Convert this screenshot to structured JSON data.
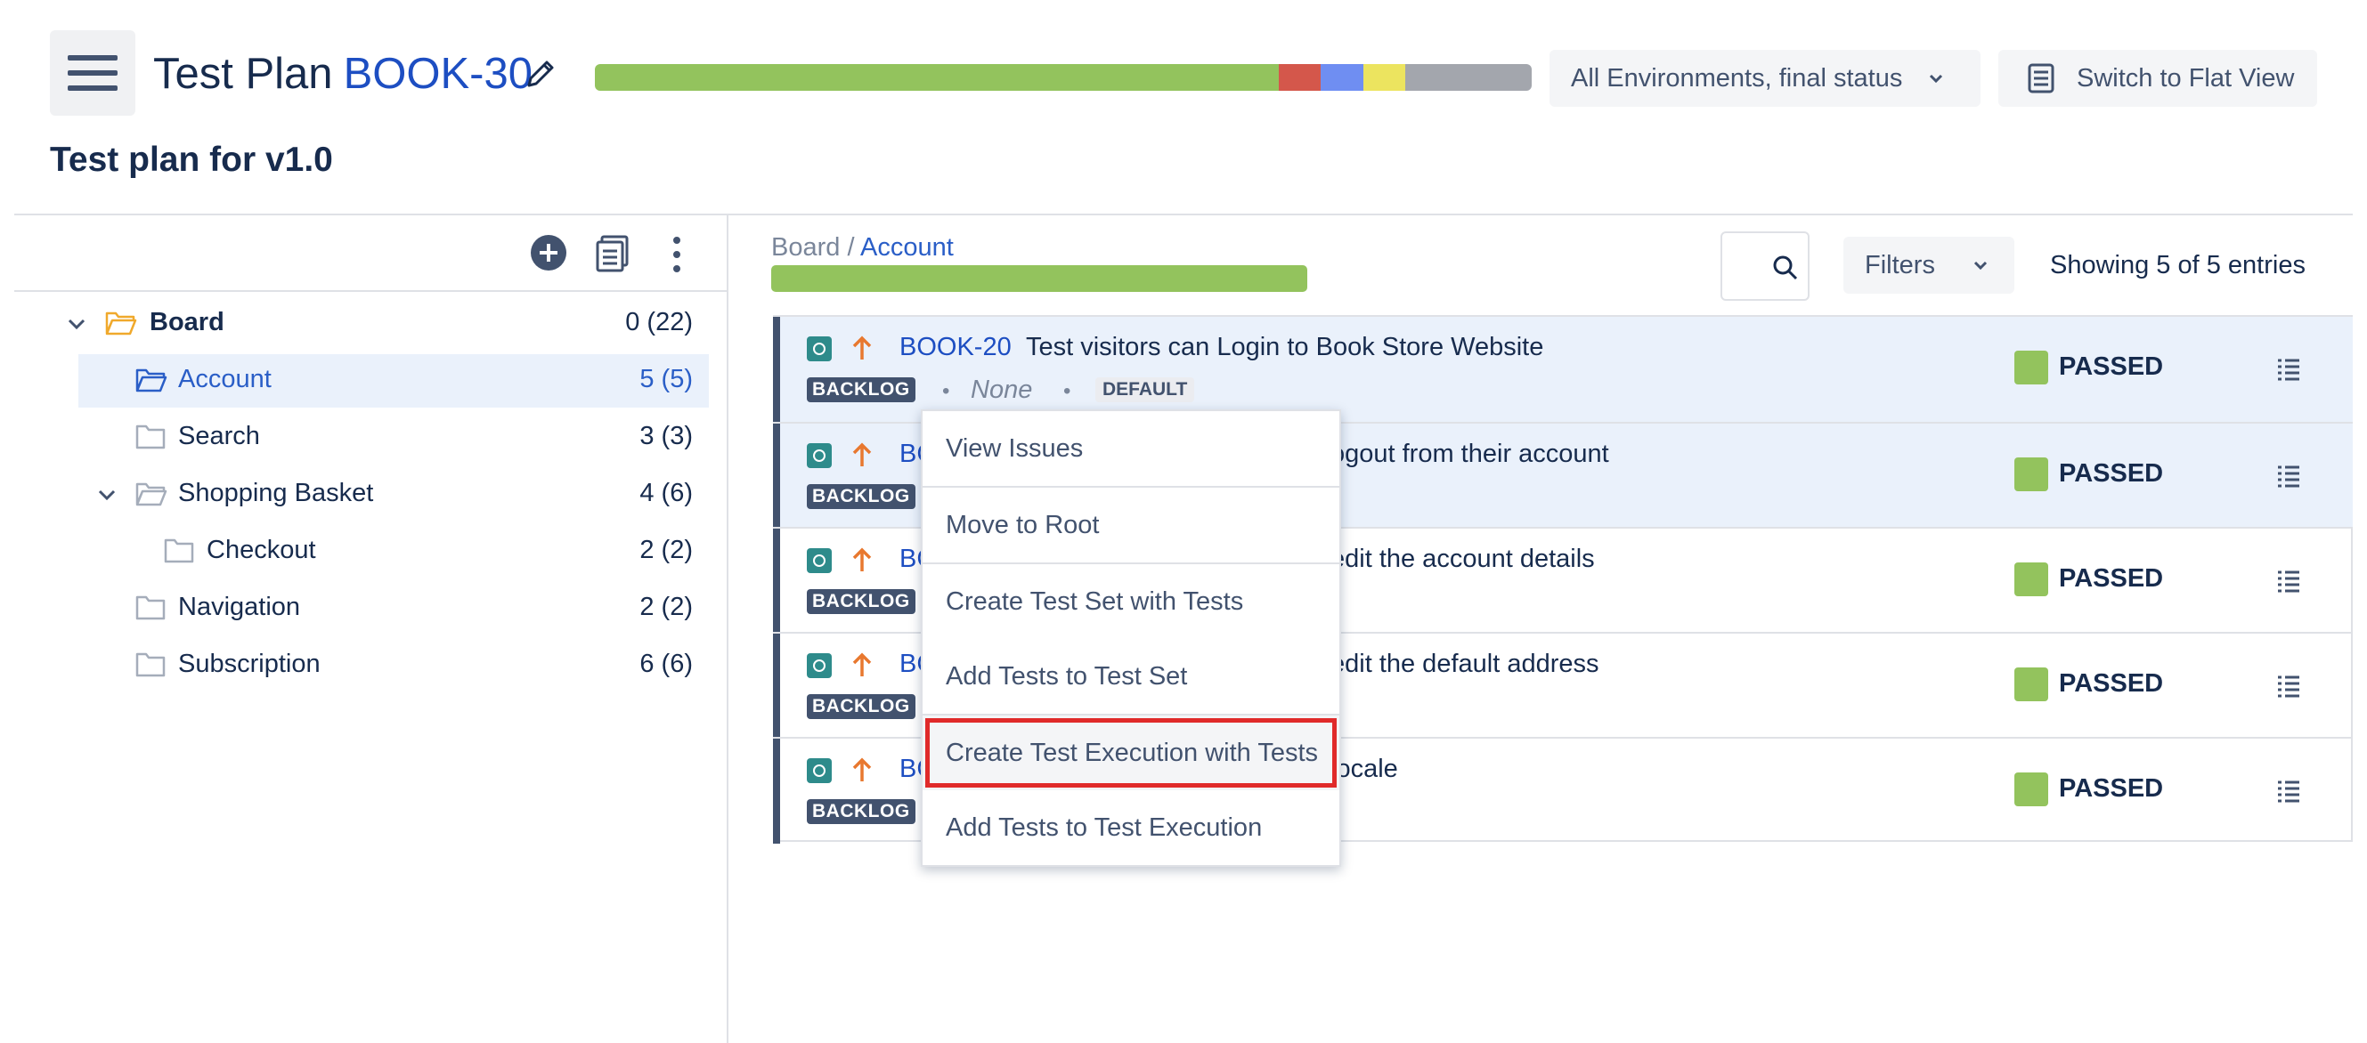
{
  "header": {
    "title": "Test Plan",
    "issue_key": "BOOK-30",
    "subtitle": "Test plan for v1.0",
    "environment_select": "All Environments, final status",
    "flat_view_label": "Switch to Flat View",
    "progress_colors": [
      "#93c35d",
      "#d4574b",
      "#6f8ef2",
      "#ece45f",
      "#a3a6ad"
    ],
    "progress_fractions": [
      0.73,
      0.045,
      0.045,
      0.045,
      0.135
    ]
  },
  "tree": {
    "items": [
      {
        "label": "Board",
        "count": "0 (22)"
      },
      {
        "label": "Account",
        "count": "5 (5)"
      },
      {
        "label": "Search",
        "count": "3 (3)"
      },
      {
        "label": "Shopping Basket",
        "count": "4 (6)"
      },
      {
        "label": "Checkout",
        "count": "2 (2)"
      },
      {
        "label": "Navigation",
        "count": "2 (2)"
      },
      {
        "label": "Subscription",
        "count": "6 (6)"
      }
    ]
  },
  "content": {
    "breadcrumb_root": "Board",
    "breadcrumb_sep": "/",
    "breadcrumb_current": "Account",
    "filters_label": "Filters",
    "entries_text": "Showing 5 of 5 entries"
  },
  "rows": [
    {
      "key": "BOOK-20",
      "summary": "Test visitors can Login to Book Store Website",
      "badge": "BACKLOG",
      "none": "None",
      "default": "DEFAULT",
      "status": "PASSED",
      "status_color": "#93c35d"
    },
    {
      "key": "BC",
      "summary": "ogout from their account",
      "badge": "BACKLOG",
      "status": "PASSED",
      "status_color": "#93c35d"
    },
    {
      "key": "BC",
      "summary": "edit the account details",
      "badge": "BACKLOG",
      "status": "PASSED",
      "status_color": "#93c35d"
    },
    {
      "key": "BC",
      "summary": "edit the default address",
      "badge": "BACKLOG",
      "status": "PASSED",
      "status_color": "#93c35d"
    },
    {
      "key": "BC",
      "summary": "locale",
      "badge": "BACKLOG",
      "status": "PASSED",
      "status_color": "#93c35d"
    }
  ],
  "context_menu": {
    "items": [
      "View Issues",
      "Move to Root",
      "Create Test Set with Tests",
      "Add Tests to Test Set",
      "Create Test Execution with Tests",
      "Add Tests to Test Execution"
    ],
    "highlighted": "Create Test Execution with Tests"
  }
}
